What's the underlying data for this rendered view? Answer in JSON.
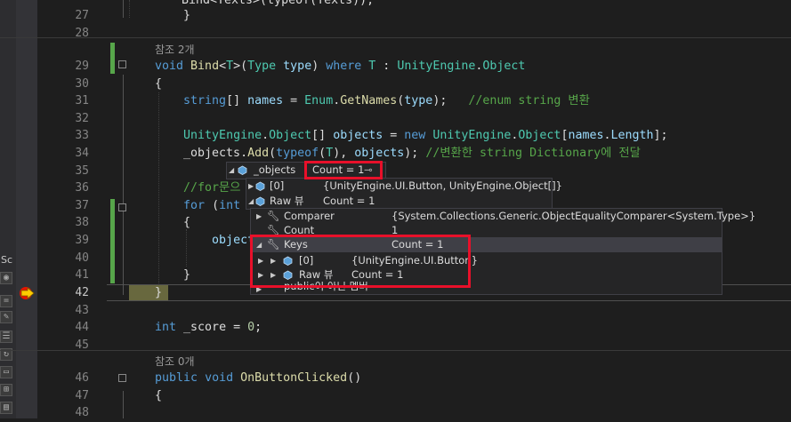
{
  "editor": {
    "lines": [
      {
        "num": "27",
        "code": [
          {
            "t": "    }",
            "c": "pl"
          }
        ]
      },
      {
        "num": "28",
        "code": []
      },
      {
        "num": "",
        "ref": "참조 2개"
      },
      {
        "num": "29",
        "code": [
          {
            "t": "void",
            "c": "kw"
          },
          {
            "t": " ",
            "c": "pl"
          },
          {
            "t": "Bind",
            "c": "fn"
          },
          {
            "t": "<",
            "c": "pl"
          },
          {
            "t": "T",
            "c": "ty"
          },
          {
            "t": ">(",
            "c": "pl"
          },
          {
            "t": "Type",
            "c": "ty"
          },
          {
            "t": " ",
            "c": "pl"
          },
          {
            "t": "type",
            "c": "pm"
          },
          {
            "t": ") ",
            "c": "pl"
          },
          {
            "t": "where",
            "c": "kw"
          },
          {
            "t": " ",
            "c": "pl"
          },
          {
            "t": "T",
            "c": "ty"
          },
          {
            "t": " : ",
            "c": "pl"
          },
          {
            "t": "UnityEngine",
            "c": "ty"
          },
          {
            "t": ".",
            "c": "pl"
          },
          {
            "t": "Object",
            "c": "ty"
          }
        ]
      },
      {
        "num": "30",
        "code": [
          {
            "t": "{",
            "c": "pl"
          }
        ]
      },
      {
        "num": "31",
        "code": [
          {
            "t": "    ",
            "c": "pl"
          },
          {
            "t": "string",
            "c": "kw"
          },
          {
            "t": "[] ",
            "c": "pl"
          },
          {
            "t": "names",
            "c": "pm"
          },
          {
            "t": " = ",
            "c": "pl"
          },
          {
            "t": "Enum",
            "c": "ty"
          },
          {
            "t": ".",
            "c": "pl"
          },
          {
            "t": "GetNames",
            "c": "fn"
          },
          {
            "t": "(",
            "c": "pl"
          },
          {
            "t": "type",
            "c": "pm"
          },
          {
            "t": ");   ",
            "c": "pl"
          },
          {
            "t": "//enum string 변환",
            "c": "cm"
          }
        ]
      },
      {
        "num": "32",
        "code": []
      },
      {
        "num": "33",
        "code": [
          {
            "t": "    ",
            "c": "pl"
          },
          {
            "t": "UnityEngine",
            "c": "ty"
          },
          {
            "t": ".",
            "c": "pl"
          },
          {
            "t": "Object",
            "c": "ty"
          },
          {
            "t": "[] ",
            "c": "pl"
          },
          {
            "t": "objects",
            "c": "pm"
          },
          {
            "t": " = ",
            "c": "pl"
          },
          {
            "t": "new",
            "c": "kw"
          },
          {
            "t": " ",
            "c": "pl"
          },
          {
            "t": "UnityEngine",
            "c": "ty"
          },
          {
            "t": ".",
            "c": "pl"
          },
          {
            "t": "Object",
            "c": "ty"
          },
          {
            "t": "[",
            "c": "pl"
          },
          {
            "t": "names",
            "c": "pm"
          },
          {
            "t": ".",
            "c": "pl"
          },
          {
            "t": "Length",
            "c": "pm"
          },
          {
            "t": "];",
            "c": "pl"
          }
        ]
      },
      {
        "num": "34",
        "code": [
          {
            "t": "    _objects.",
            "c": "pl"
          },
          {
            "t": "Add",
            "c": "fn"
          },
          {
            "t": "(",
            "c": "pl"
          },
          {
            "t": "typeof",
            "c": "kw"
          },
          {
            "t": "(",
            "c": "pl"
          },
          {
            "t": "T",
            "c": "ty"
          },
          {
            "t": "), ",
            "c": "pl"
          },
          {
            "t": "objects",
            "c": "pm"
          },
          {
            "t": "); ",
            "c": "pl"
          },
          {
            "t": "//변환한 string Dictionary에 전달",
            "c": "cm"
          }
        ]
      },
      {
        "num": "35",
        "code": []
      },
      {
        "num": "36",
        "code": [
          {
            "t": "    ",
            "c": "pl"
          },
          {
            "t": "//for문으",
            "c": "cm"
          }
        ]
      },
      {
        "num": "37",
        "code": [
          {
            "t": "    ",
            "c": "pl"
          },
          {
            "t": "for",
            "c": "kw"
          },
          {
            "t": " (",
            "c": "pl"
          },
          {
            "t": "int",
            "c": "kw"
          }
        ]
      },
      {
        "num": "38",
        "code": [
          {
            "t": "    {",
            "c": "pl"
          }
        ]
      },
      {
        "num": "39",
        "code": [
          {
            "t": "        ",
            "c": "pl"
          },
          {
            "t": "object",
            "c": "pm"
          }
        ]
      },
      {
        "num": "40",
        "code": []
      },
      {
        "num": "41",
        "code": [
          {
            "t": "    }",
            "c": "pl"
          }
        ]
      },
      {
        "num": "42",
        "code": [
          {
            "t": "}",
            "c": "pl"
          }
        ]
      },
      {
        "num": "43",
        "code": []
      },
      {
        "num": "44",
        "code": [
          {
            "t": "int",
            "c": "kw"
          },
          {
            "t": " _score = ",
            "c": "pl"
          },
          {
            "t": "0",
            "c": "nm"
          },
          {
            "t": ";",
            "c": "pl"
          }
        ]
      },
      {
        "num": "45",
        "code": []
      },
      {
        "num": "",
        "ref": "참조 0개"
      },
      {
        "num": "46",
        "code": [
          {
            "t": "public",
            "c": "kw"
          },
          {
            "t": " ",
            "c": "pl"
          },
          {
            "t": "void",
            "c": "kw"
          },
          {
            "t": " ",
            "c": "pl"
          },
          {
            "t": "OnButtonClicked",
            "c": "fn"
          },
          {
            "t": "()",
            "c": "pl"
          }
        ]
      },
      {
        "num": "47",
        "code": [
          {
            "t": "{",
            "c": "pl"
          }
        ]
      },
      {
        "num": "48",
        "code": []
      }
    ],
    "top_partial_code": "Bind<Texts>(typeof(Texts));",
    "left_strip_label": "Sc"
  },
  "datatip": {
    "root": {
      "name": "_objects",
      "value": "Count = 1"
    },
    "level1": [
      {
        "name": "[0]",
        "value": "{UnityEngine.UI.Button, UnityEngine.Object[]}"
      },
      {
        "name": "Raw 뷰",
        "value": "Count = 1"
      }
    ],
    "level2": [
      {
        "name": "Comparer",
        "value": "{System.Collections.Generic.ObjectEqualityComparer<System.Type>}"
      },
      {
        "name": "Count",
        "value": "1"
      },
      {
        "name": "Keys",
        "value": "Count = 1"
      },
      {
        "name": "[0]",
        "value": "{UnityEngine.UI.Button}"
      },
      {
        "name": "Raw 뷰",
        "value": "Count = 1"
      },
      {
        "name": "public이 아닌 멤버",
        "value": ""
      }
    ]
  },
  "colors": {
    "accent_red": "#e8102a",
    "changed": "#57a64a",
    "breakpoint": "#e51400",
    "arrow": "#ffcc00"
  }
}
